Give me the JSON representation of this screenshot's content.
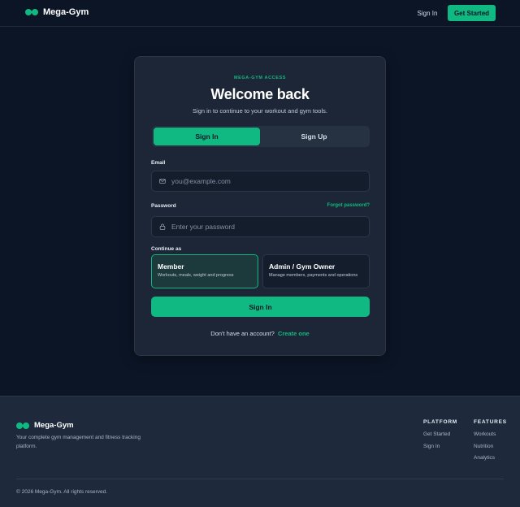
{
  "header": {
    "brand": "Mega-Gym",
    "sign_in": "Sign In",
    "get_started": "Get Started"
  },
  "card": {
    "eyebrow": "MEGA-GYM ACCESS",
    "title": "Welcome back",
    "subtitle": "Sign in to continue to your workout and gym tools.",
    "tabs": [
      {
        "label": "Sign In",
        "active": true
      },
      {
        "label": "Sign Up",
        "active": false
      }
    ],
    "email": {
      "label": "Email",
      "placeholder": "you@example.com",
      "icon": "mail-icon"
    },
    "password": {
      "label": "Password",
      "placeholder": "Enter your password",
      "forgot": "Forgot password?",
      "icon": "lock-icon"
    },
    "continue_as": "Continue as",
    "roles": [
      {
        "title": "Member",
        "desc": "Workouts, meals, weight and progress",
        "selected": true
      },
      {
        "title": "Admin / Gym Owner",
        "desc": "Manage members, payments and operations",
        "selected": false
      }
    ],
    "submit": "Sign In",
    "switch_text": "Don't have an account?",
    "switch_link": "Create one"
  },
  "footer": {
    "brand": "Mega-Gym",
    "description": "Your complete gym management and fitness tracking platform.",
    "columns": [
      {
        "heading": "PLATFORM",
        "links": [
          "Get Started",
          "Sign In"
        ]
      },
      {
        "heading": "FEATURES",
        "links": [
          "Workouts",
          "Nutrition",
          "Analytics"
        ]
      }
    ],
    "copyright": "© 2026 Mega-Gym. All rights reserved."
  },
  "colors": {
    "accent": "#10b981",
    "background": "#0c1526",
    "card": "#1c2636",
    "footer": "#1e2a3c"
  }
}
